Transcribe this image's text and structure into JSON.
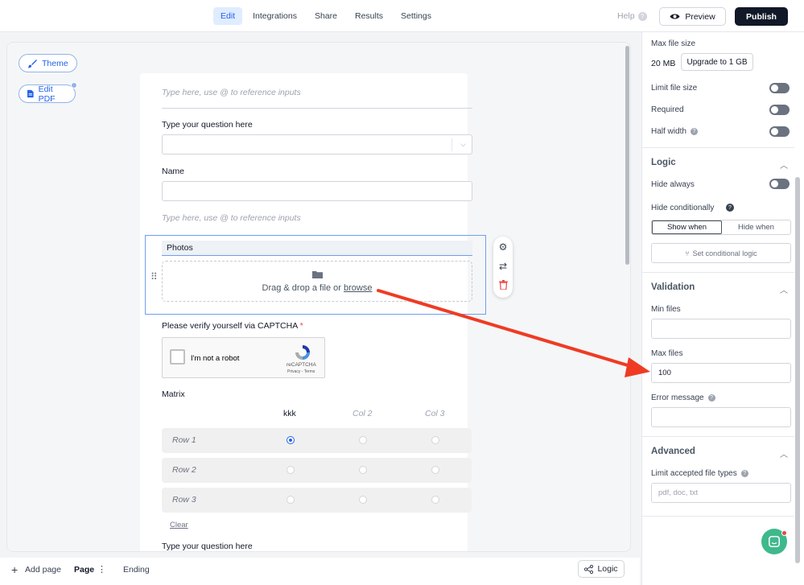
{
  "topbar": {
    "tabs": [
      "Edit",
      "Integrations",
      "Share",
      "Results",
      "Settings"
    ],
    "active_tab": "Edit",
    "help_label": "Help",
    "preview_label": "Preview",
    "publish_label": "Publish"
  },
  "canvas": {
    "theme_label": "Theme",
    "edit_pdf_label": "Edit PDF"
  },
  "form": {
    "placeholder_1": "Type here, use @ to reference inputs",
    "question_1": "Type your question here",
    "name_label": "Name",
    "placeholder_2": "Type here, use @ to reference inputs",
    "photos_label": "Photos",
    "dropzone_text": "Drag & drop a file or ",
    "dropzone_link": "browse",
    "captcha_title": "Please verify yourself via CAPTCHA",
    "captcha_required": "*",
    "captcha_text": "I'm not a robot",
    "captcha_brand": "reCAPTCHA",
    "captcha_footer": "Privacy - Terms",
    "matrix_label": "Matrix",
    "matrix_columns": [
      "kkk",
      "Col 2",
      "Col 3"
    ],
    "matrix_rows": [
      "Row 1",
      "Row 2",
      "Row 3"
    ],
    "matrix_selected": {
      "row": 0,
      "col": 0
    },
    "clear_label": "Clear",
    "question_2": "Type your question here"
  },
  "bottombar": {
    "add_page": "Add page",
    "page_tab": "Page",
    "ending_tab": "Ending",
    "logic_label": "Logic"
  },
  "panel": {
    "max_file_size_label": "Max file size",
    "max_file_size_value": "20 MB",
    "upgrade_label": "Upgrade to 1 GB",
    "limit_file_size": "Limit file size",
    "required": "Required",
    "half_width": "Half width",
    "logic_head": "Logic",
    "hide_always": "Hide always",
    "hide_conditionally": "Hide conditionally",
    "show_when": "Show when",
    "hide_when": "Hide when",
    "set_conditional": "Set conditional logic",
    "validation_head": "Validation",
    "min_files": "Min files",
    "min_files_value": "",
    "max_files": "Max files",
    "max_files_value": "100",
    "error_message": "Error message",
    "error_message_value": "",
    "advanced_head": "Advanced",
    "limit_types": "Limit accepted file types",
    "limit_types_placeholder": "pdf, doc, txt"
  },
  "colors": {
    "accent": "#2563eb",
    "arrow": "#ef3b24",
    "publish_bg": "#111827",
    "chat_fab": "#3fb98c"
  }
}
